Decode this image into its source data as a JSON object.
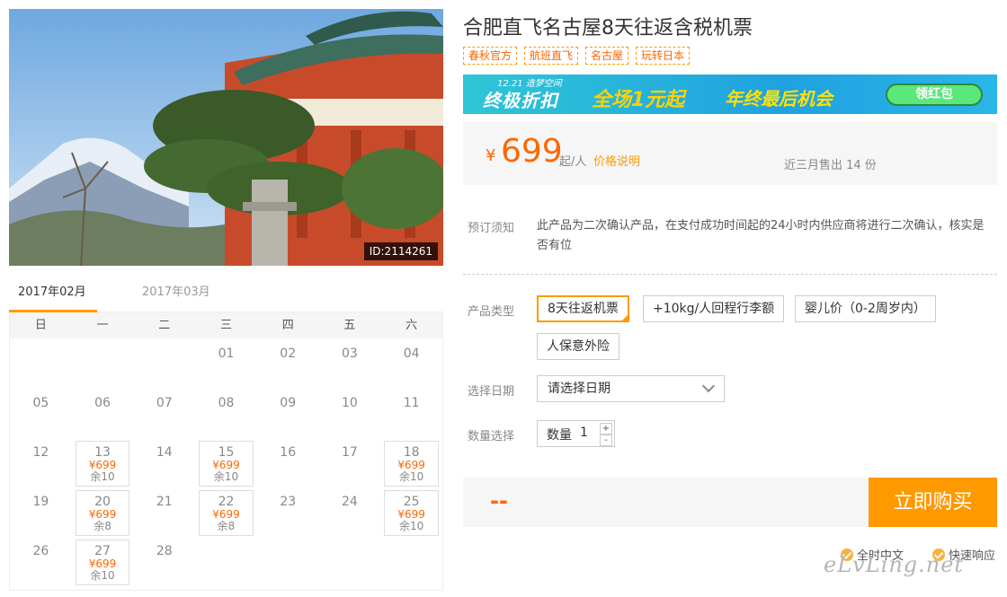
{
  "product": {
    "title": "合肥直飞名古屋8天往返含税机票",
    "image_id": "ID:2114261",
    "tags": [
      "春秋官方",
      "航班直飞",
      "名古屋",
      "玩转日本"
    ]
  },
  "banner": {
    "small_text": "12.21 造梦空间",
    "main_text": "终极折扣",
    "mid_text": "全场1元起",
    "right_text": "年终最后机会",
    "button": "领红包"
  },
  "price": {
    "currency": "¥",
    "amount": "699",
    "unit": "起/人",
    "note": "价格说明",
    "sold": "近三月售出 14 份"
  },
  "notice": {
    "label": "预订须知",
    "text": "此产品为二次确认产品，在支付成功时间起的24小时内供应商将进行二次确认，核实是否有位"
  },
  "product_type": {
    "label": "产品类型",
    "options": [
      "8天往返机票",
      "+10kg/人回程行李额",
      "婴儿价（0-2周岁内）",
      "人保意外险"
    ],
    "selected": 0
  },
  "date_select": {
    "label": "选择日期",
    "value": "请选择日期"
  },
  "quantity": {
    "label": "数量选择",
    "field_label": "数量",
    "value": "1",
    "plus": "+",
    "minus": "-"
  },
  "purchase": {
    "total": "--",
    "button": "立即购买"
  },
  "services": [
    "全时中文",
    "快速响应"
  ],
  "watermark": "eLvLing.net",
  "calendar": {
    "tabs": [
      "2017年02月",
      "2017年03月"
    ],
    "active_tab": 0,
    "weekdays": [
      "日",
      "一",
      "二",
      "三",
      "四",
      "五",
      "六"
    ],
    "days": [
      {
        "d": ""
      },
      {
        "d": ""
      },
      {
        "d": ""
      },
      {
        "d": "01"
      },
      {
        "d": "02"
      },
      {
        "d": "03"
      },
      {
        "d": "04"
      },
      {
        "d": "05"
      },
      {
        "d": "06"
      },
      {
        "d": "07"
      },
      {
        "d": "08"
      },
      {
        "d": "09"
      },
      {
        "d": "10"
      },
      {
        "d": "11"
      },
      {
        "d": "12"
      },
      {
        "d": "13",
        "price": "¥699",
        "stock": "余10"
      },
      {
        "d": "14"
      },
      {
        "d": "15",
        "price": "¥699",
        "stock": "余10"
      },
      {
        "d": "16"
      },
      {
        "d": "17"
      },
      {
        "d": "18",
        "price": "¥699",
        "stock": "余10"
      },
      {
        "d": "19"
      },
      {
        "d": "20",
        "price": "¥699",
        "stock": "余8"
      },
      {
        "d": "21"
      },
      {
        "d": "22",
        "price": "¥699",
        "stock": "余8"
      },
      {
        "d": "23"
      },
      {
        "d": "24"
      },
      {
        "d": "25",
        "price": "¥699",
        "stock": "余10"
      },
      {
        "d": "26"
      },
      {
        "d": "27",
        "price": "¥699",
        "stock": "余10"
      },
      {
        "d": "28"
      }
    ]
  }
}
